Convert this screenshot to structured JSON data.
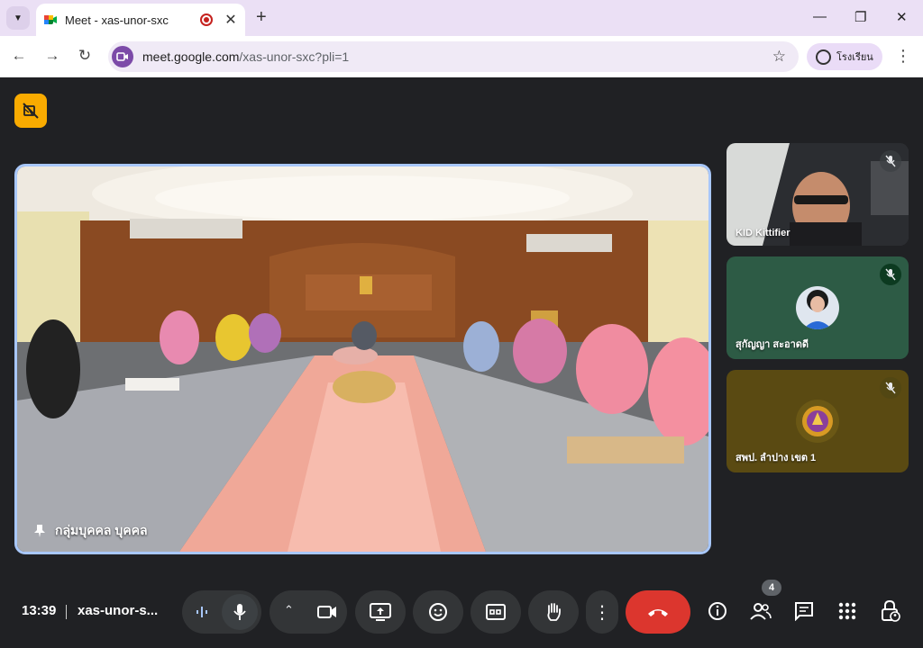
{
  "browser": {
    "tab_title": "Meet - xas-unor-sxc",
    "new_tab_label": "+",
    "url_host": "meet.google.com",
    "url_path": "/xas-unor-sxc?pli=1",
    "profile_label": "โรงเรียน"
  },
  "meet": {
    "main_participant": "กลุ่มบุคคล บุคคล",
    "participants": [
      {
        "name": "KID Kittifier"
      },
      {
        "name": "สุกัญญา สะอาดดี"
      },
      {
        "name": "สพป. ลำปาง เขต 1"
      }
    ],
    "time": "13:39",
    "meeting_code": "xas-unor-s...",
    "participant_count": "4"
  },
  "colors": {
    "accent_border": "#a8c7fa",
    "hangup": "#dc362e",
    "warning_badge": "#f9ab00"
  }
}
